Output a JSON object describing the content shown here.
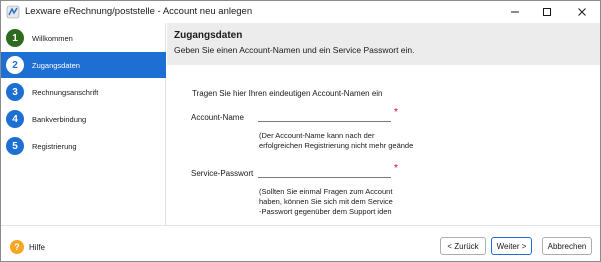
{
  "window": {
    "title": "Lexware eRechnung/poststelle - Account neu anlegen"
  },
  "sidebar": {
    "steps": [
      {
        "number": "1",
        "label": "Willkommen",
        "state": "done"
      },
      {
        "number": "2",
        "label": "Zugangsdaten",
        "state": "current"
      },
      {
        "number": "3",
        "label": "Rechnungsanschrift",
        "state": "todo"
      },
      {
        "number": "4",
        "label": "Bankverbindung",
        "state": "todo"
      },
      {
        "number": "5",
        "label": "Registrierung",
        "state": "todo"
      }
    ]
  },
  "header": {
    "title": "Zugangsdaten",
    "subtitle": "Geben Sie einen Account-Namen und ein Service Passwort ein."
  },
  "form": {
    "intro": "Tragen Sie hier Ihren eindeutigen Account-Namen ein",
    "account_name": {
      "label": "Account-Name",
      "value": "",
      "required_mark": "*",
      "note_line1": "(Der Account-Name kann nach der",
      "note_line2": "erfolgreichen Registrierung nicht mehr geände"
    },
    "service_password": {
      "label": "Service-Passwort",
      "value": "",
      "required_mark": "*",
      "note_line1": "(Sollten Sie einmal Fragen zum Account",
      "note_line2": "haben, können Sie sich mit dem Service",
      "note_line3": "-Passwort gegenüber dem Support iden"
    }
  },
  "footer": {
    "help_label": "Hilfe",
    "back_label": "< Zurück",
    "next_label": "Weiter >",
    "cancel_label": "Abbrechen"
  },
  "colors": {
    "accent": "#1e6fd3",
    "done": "#2e6b1f",
    "required": "#d0021b",
    "help": "#f5a623"
  }
}
